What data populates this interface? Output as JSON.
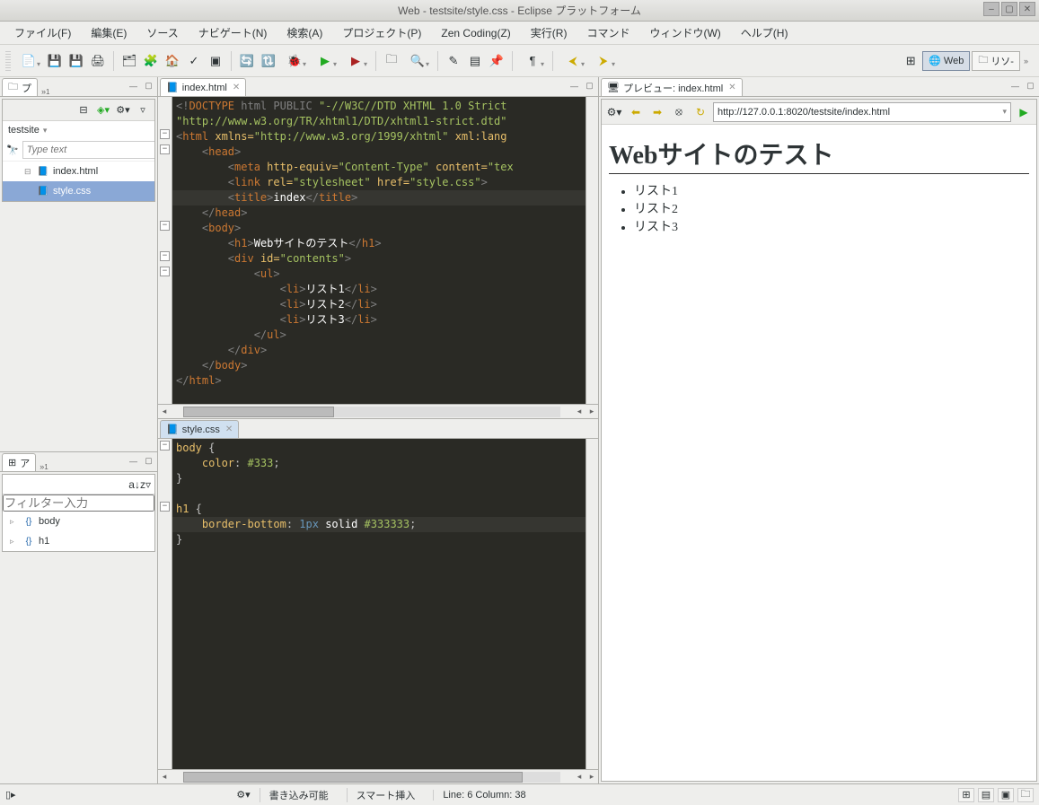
{
  "window": {
    "title": "Web - testsite/style.css - Eclipse プラットフォーム"
  },
  "menu": {
    "file": "ファイル(F)",
    "edit": "編集(E)",
    "source": "ソース",
    "navigate": "ナビゲート(N)",
    "search": "検索(A)",
    "project": "プロジェクト(P)",
    "zen": "Zen Coding(Z)",
    "run": "実行(R)",
    "commands": "コマンド",
    "window": "ウィンドウ(W)",
    "help": "ヘルプ(H)"
  },
  "perspectives": {
    "web": "Web",
    "resource": "リソ-"
  },
  "projectExplorer": {
    "tab": "プ",
    "project": "testsite",
    "filter_placeholder": "Type text",
    "files": {
      "index": "index.html",
      "style": "style.css"
    }
  },
  "outline": {
    "tab": "ア",
    "filter_placeholder": "フィルター入力",
    "items": {
      "body": "body",
      "h1": "h1"
    }
  },
  "editor1": {
    "tab": "index.html",
    "lines": {
      "l1a": "<!",
      "l1b": "DOCTYPE",
      "l1c": " html PUBLIC ",
      "l1d": "\"-//W3C//DTD XHTML 1.0 Strict",
      "l2": "\"http://www.w3.org/TR/xhtml1/DTD/xhtml1-strict.dtd\"",
      "l3a": "<",
      "l3b": "html",
      "l3c": " xmlns=",
      "l3d": "\"http://www.w3.org/1999/xhtml\"",
      "l3e": " xml:lang",
      "l4a": "    <",
      "l4b": "head",
      "l4c": ">",
      "l5a": "        <",
      "l5b": "meta",
      "l5c": " http-equiv=",
      "l5d": "\"Content-Type\"",
      "l5e": " content=",
      "l5f": "\"tex",
      "l6a": "        <",
      "l6b": "link",
      "l6c": " rel=",
      "l6d": "\"stylesheet\"",
      "l6e": " href=",
      "l6f": "\"style.css\"",
      "l6g": ">",
      "l7a": "        <",
      "l7b": "title",
      "l7c": ">",
      "l7d": "index",
      "l7e": "</",
      "l7f": "title",
      "l7g": ">",
      "l8a": "    </",
      "l8b": "head",
      "l8c": ">",
      "l9a": "    <",
      "l9b": "body",
      "l9c": ">",
      "l10a": "        <",
      "l10b": "h1",
      "l10c": ">",
      "l10d": "Webサイトのテスト",
      "l10e": "</",
      "l10f": "h1",
      "l10g": ">",
      "l11a": "        <",
      "l11b": "div",
      "l11c": " id=",
      "l11d": "\"contents\"",
      "l11e": ">",
      "l12a": "            <",
      "l12b": "ul",
      "l12c": ">",
      "l13a": "                <",
      "l13b": "li",
      "l13c": ">",
      "l13d": "リスト1",
      "l13e": "</",
      "l13f": "li",
      "l13g": ">",
      "l14a": "                <",
      "l14b": "li",
      "l14c": ">",
      "l14d": "リスト2",
      "l14e": "</",
      "l14f": "li",
      "l14g": ">",
      "l15a": "                <",
      "l15b": "li",
      "l15c": ">",
      "l15d": "リスト3",
      "l15e": "</",
      "l15f": "li",
      "l15g": ">",
      "l16a": "            </",
      "l16b": "ul",
      "l16c": ">",
      "l17a": "        </",
      "l17b": "div",
      "l17c": ">",
      "l18a": "    </",
      "l18b": "body",
      "l18c": ">",
      "l19a": "</",
      "l19b": "html",
      "l19c": ">"
    }
  },
  "editor2": {
    "tab": "style.css",
    "lines": {
      "l1a": "body",
      "l1b": " {",
      "l2a": "    ",
      "l2b": "color",
      "l2c": ": ",
      "l2d": "#333",
      "l2e": ";",
      "l3": "}",
      "l4": "",
      "l5a": "h1",
      "l5b": " {",
      "l6a": "    ",
      "l6b": "border-bottom",
      "l6c": ": ",
      "l6d": "1px",
      "l6e": " solid ",
      "l6f": "#333333",
      "l6g": ";",
      "l7": "}"
    }
  },
  "preview": {
    "tab": "プレビュー: index.html",
    "url": "http://127.0.0.1:8020/testsite/index.html",
    "h1": "Webサイトのテスト",
    "li1": "リスト1",
    "li2": "リスト2",
    "li3": "リスト3"
  },
  "status": {
    "writable": "書き込み可能",
    "insert": "スマート挿入",
    "pos": "Line: 6 Column: 38"
  }
}
